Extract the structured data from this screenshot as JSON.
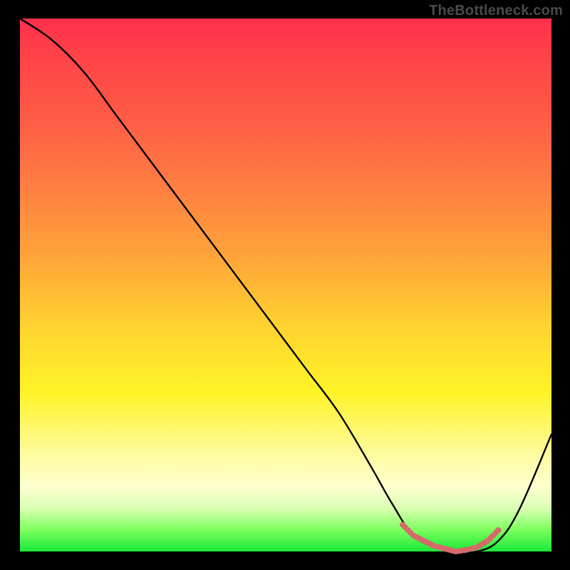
{
  "watermark": "TheBottleneck.com",
  "chart_data": {
    "type": "line",
    "title": "",
    "xlabel": "",
    "ylabel": "",
    "xlim": [
      0,
      100
    ],
    "ylim": [
      0,
      100
    ],
    "series": [
      {
        "name": "bottleneck-curve",
        "x": [
          0,
          6,
          12,
          18,
          24,
          30,
          36,
          42,
          48,
          54,
          60,
          66,
          70,
          74,
          78,
          82,
          86,
          90,
          94,
          100
        ],
        "y": [
          100,
          96,
          90,
          82,
          74,
          66,
          58,
          50,
          42,
          34,
          26,
          16,
          9,
          3,
          1,
          0,
          0,
          2,
          8,
          22
        ]
      },
      {
        "name": "optimal-range-marker",
        "x": [
          72,
          74,
          76,
          78,
          80,
          82,
          84,
          86,
          88,
          90
        ],
        "y": [
          5,
          3,
          2,
          1,
          0.5,
          0,
          0.3,
          0.8,
          2,
          4
        ]
      }
    ],
    "colors": {
      "curve": "#000000",
      "marker": "#d66a6a",
      "gradient_top": "#ff2f4d",
      "gradient_mid": "#ffd42f",
      "gradient_bottom": "#17e83a"
    }
  }
}
